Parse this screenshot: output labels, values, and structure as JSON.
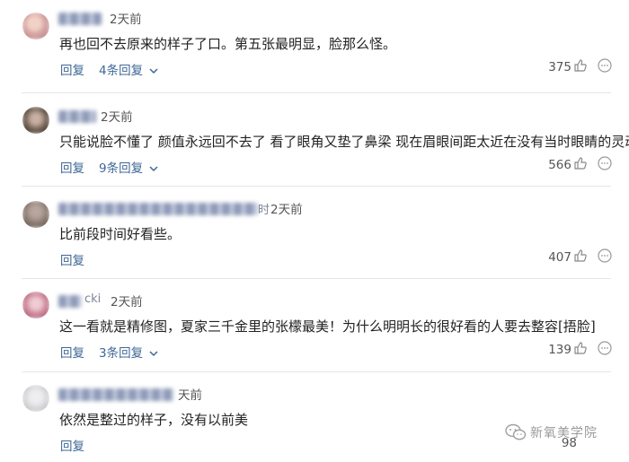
{
  "comments": [
    {
      "time": "2天前",
      "text": "再也回不去原来的样子了口。第五张最明显，脸那么怪。",
      "reply_label": "回复",
      "replies_label": "4条回复",
      "likes": "375",
      "avatar_color": "#d7a6a6"
    },
    {
      "time": "2天前",
      "text": "只能说脸不懂了 颜值永远回不去了 看了眼角又垫了鼻梁 现在眉眼间距太近在没有当时眼睛的灵动",
      "reply_label": "回复",
      "replies_label": "9条回复",
      "likes": "566",
      "avatar_color": "#6b5b4e"
    },
    {
      "name_tail": "时",
      "time": "2天前",
      "text": "比前段时间好看些。",
      "reply_label": "回复",
      "likes": "407",
      "avatar_color": "#8a7a72"
    },
    {
      "name_tail": "cki",
      "time": "2天前",
      "text": "这一看就是精修图，夏家三千金里的张檬最美！为什么明明长的很好看的人要去整容[捂脸]",
      "reply_label": "回复",
      "replies_label": "3条回复",
      "likes": "139",
      "avatar_color": "#c97f92"
    },
    {
      "time": "天前",
      "text": "依然是整过的样子，没有以前美",
      "reply_label": "回复",
      "likes": "98",
      "avatar_color": "#d3d3d6"
    }
  ],
  "watermark": {
    "text": "新氧美学院"
  },
  "colors": {
    "link": "#3e6796",
    "divider": "#e6e6e6",
    "muted": "#555555"
  }
}
